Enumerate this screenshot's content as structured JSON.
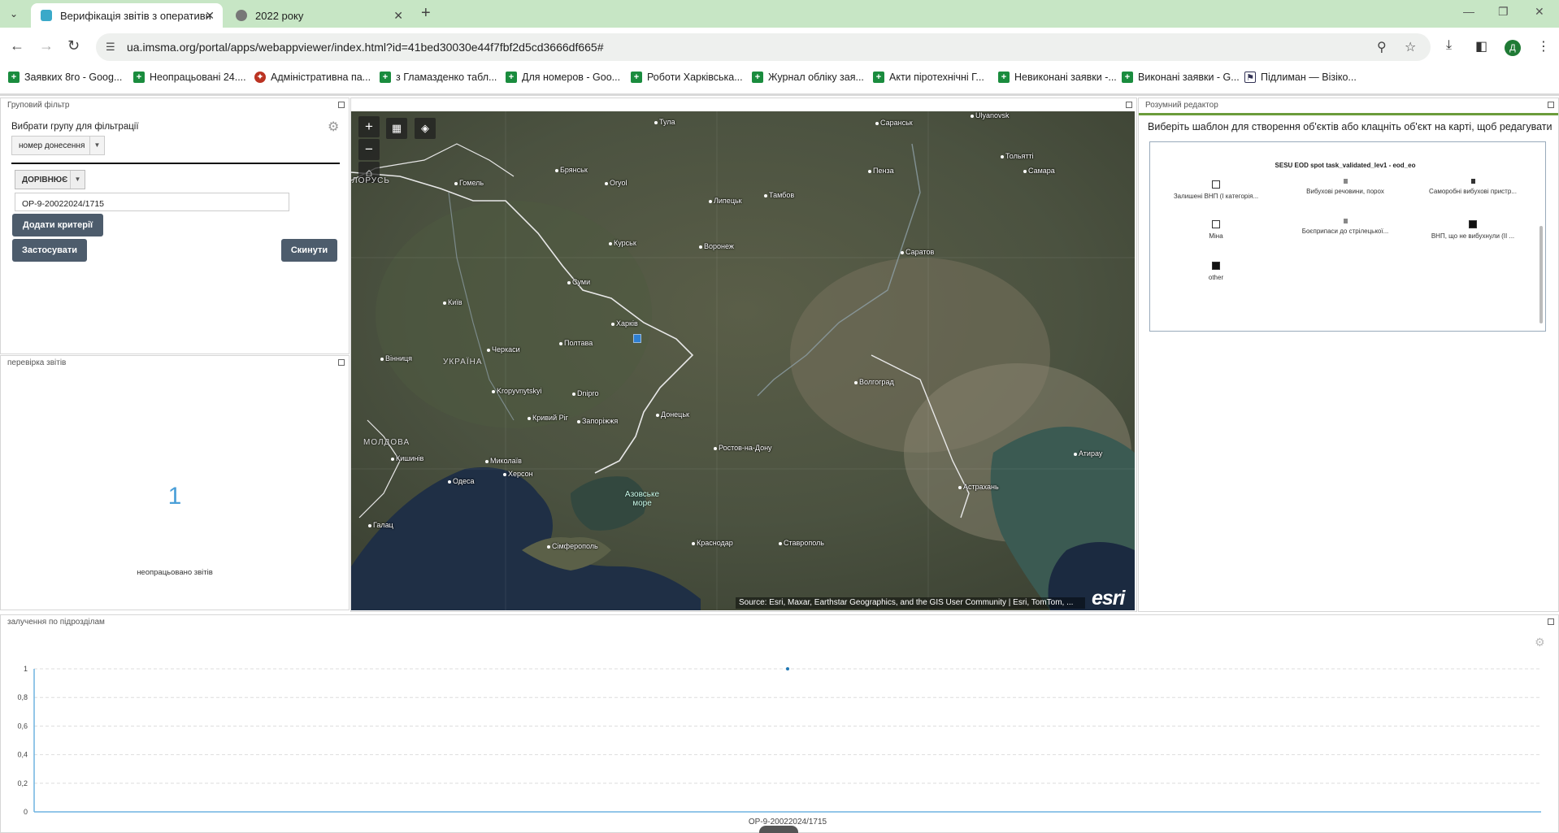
{
  "browser": {
    "tabs": [
      {
        "title": "Верифікація звітів з оперативн",
        "active": true
      },
      {
        "title": "2022 року",
        "active": false
      }
    ],
    "url": "ua.imsma.org/portal/apps/webappviewer/index.html?id=41bed30030e44f7fbf2d5cd3666df665#",
    "profile_initial": "Д",
    "bookmarks": [
      {
        "label": "Заявких 8го - Goog..."
      },
      {
        "label": "Неопрацьовані 24...."
      },
      {
        "label": "Адміністративна па..."
      },
      {
        "label": "з Гламазденко табл..."
      },
      {
        "label": "Для номеров - Goo..."
      },
      {
        "label": "Роботи Харківська..."
      },
      {
        "label": "Журнал обліку зая..."
      },
      {
        "label": "Акти піротехнічні Г..."
      },
      {
        "label": "Невиконані заявки -..."
      },
      {
        "label": "Виконані заявки - G..."
      },
      {
        "label": "Підлиман — Візіко..."
      }
    ]
  },
  "group_filter": {
    "title": "Груповий фільтр",
    "label": "Вибрати групу для фільтрації",
    "group_value": "номер донесення",
    "operator": "ДОРІВНЮЄ",
    "value": "OP-9-20022024/1715",
    "add_criteria_button": "Додати критерії",
    "apply_button": "Застосувати",
    "reset_button": "Скинути"
  },
  "report_check": {
    "title": "перевірка звітів",
    "count": "1",
    "caption": "неопрацьовано звітів"
  },
  "map": {
    "cities": [
      {
        "name": "Тула"
      },
      {
        "name": "Саранськ"
      },
      {
        "name": "Ulyanovsk"
      },
      {
        "name": "Брянськ"
      },
      {
        "name": "Oryol"
      },
      {
        "name": "Липецьк"
      },
      {
        "name": "Пенза"
      },
      {
        "name": "Тольятті"
      },
      {
        "name": "Самара"
      },
      {
        "name": "Тамбов"
      },
      {
        "name": "Гомель"
      },
      {
        "name": "Курськ"
      },
      {
        "name": "Воронеж"
      },
      {
        "name": "Саратов"
      },
      {
        "name": "Суми"
      },
      {
        "name": "Київ"
      },
      {
        "name": "Харків"
      },
      {
        "name": "Полтава"
      },
      {
        "name": "Черкаси"
      },
      {
        "name": "Вінниця"
      },
      {
        "name": "Kropyvnytskyi"
      },
      {
        "name": "Dnipro"
      },
      {
        "name": "Волгоград"
      },
      {
        "name": "Кривий Ріг"
      },
      {
        "name": "Запоріжжя"
      },
      {
        "name": "Донецьк"
      },
      {
        "name": "Ростов-на-Дону"
      },
      {
        "name": "Кишинів"
      },
      {
        "name": "Миколаїв"
      },
      {
        "name": "Херсон"
      },
      {
        "name": "Одеса"
      },
      {
        "name": "Атирау"
      },
      {
        "name": "Астрахань"
      },
      {
        "name": "Галац"
      },
      {
        "name": "Сімферополь"
      },
      {
        "name": "Краснодар"
      },
      {
        "name": "Ставрополь"
      }
    ],
    "countries": [
      {
        "name": "УКРАЇНА"
      },
      {
        "name": "МОЛДОВА"
      },
      {
        "name": "ЛОРУСЬ"
      }
    ],
    "sea_label": "Азовське море",
    "attribution": "Source: Esri, Maxar, Earthstar Geographics, and the GIS User Community | Esri, TomTom, ...",
    "esri_logo": "esri",
    "tool_icons": [
      "zoom-in-icon",
      "zoom-out-icon",
      "home-icon",
      "basemap-gallery-icon",
      "layers-icon"
    ]
  },
  "smart_editor": {
    "title": "Розумний редактор",
    "instruction": "Виберіть шаблон для створення об'єктів або клацніть об'єкт на карті, щоб редагувати",
    "layer_name": "SESU EOD spot task_validated_lev1 - eod_eo",
    "templates": [
      {
        "label": "Залишені ВНП (І категорія..."
      },
      {
        "label": "Вибухові речовини, порох"
      },
      {
        "label": "Саморобні вибухові пристр..."
      },
      {
        "label": "Міна"
      },
      {
        "label": "Боєприпаси до стрілецької..."
      },
      {
        "label": "ВНП, що не вибухнули (ІІ ..."
      },
      {
        "label": "other"
      }
    ]
  },
  "chart_panel": {
    "title": "залучення по підрозділам",
    "chart_data": {
      "type": "line",
      "categories": [
        "OP-9-20022024/1715"
      ],
      "values": [
        1
      ],
      "title": "",
      "xlabel": "",
      "ylabel": "",
      "ylim": [
        0,
        1
      ],
      "yticks": [
        "0",
        "0,2",
        "0,4",
        "0,6",
        "0,8",
        "1"
      ],
      "grid": true,
      "color": "#1f77b4"
    }
  },
  "colors": {
    "tabbar": "#c7e6c5",
    "button_dark": "#4d5c6c",
    "accent_green": "#6b9c3b",
    "count_blue": "#4a9fd8"
  }
}
